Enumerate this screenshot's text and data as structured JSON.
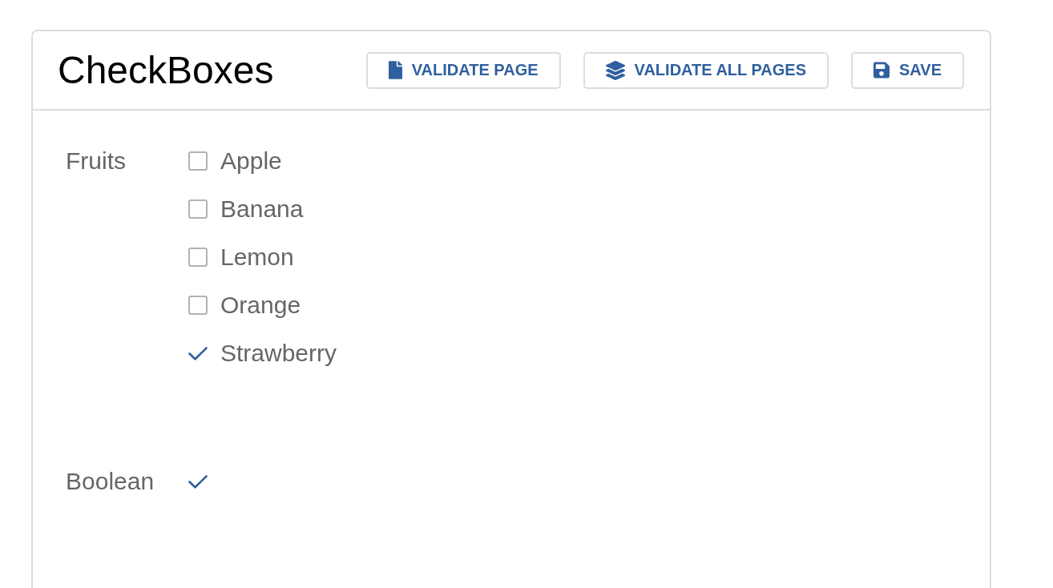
{
  "header": {
    "title": "CheckBoxes",
    "buttons": [
      "VALIDATE PAGE",
      "VALIDATE ALL PAGES",
      "SAVE"
    ]
  },
  "fields": [
    {
      "label": "Fruits",
      "kind": "group",
      "options": [
        {
          "label": "Apple",
          "checked": false
        },
        {
          "label": "Banana",
          "checked": false
        },
        {
          "label": "Lemon",
          "checked": false
        },
        {
          "label": "Orange",
          "checked": false
        },
        {
          "label": "Strawberry",
          "checked": true
        }
      ]
    },
    {
      "label": "Boolean",
      "kind": "single",
      "checked": true
    }
  ]
}
